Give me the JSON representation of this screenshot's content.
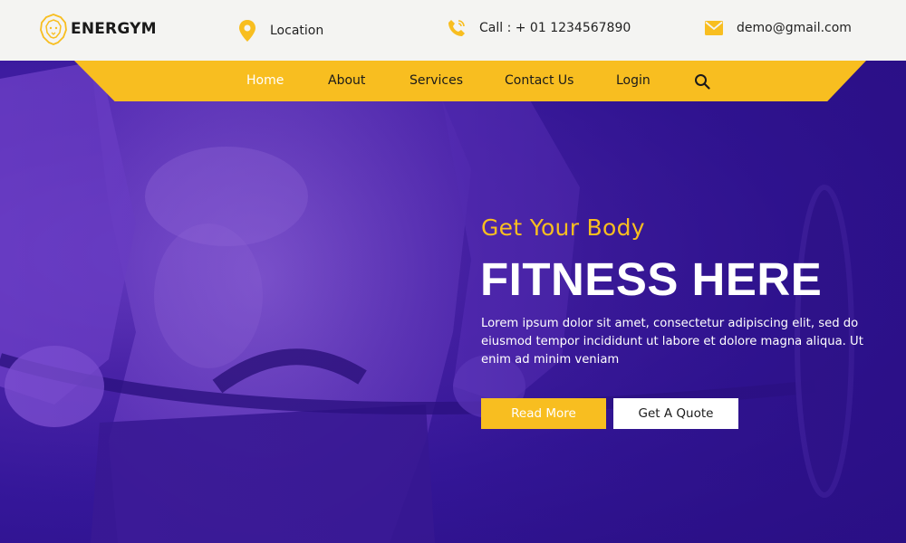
{
  "brand": {
    "name": "ENERGYM",
    "logo_icon": "lion-icon"
  },
  "contact": {
    "location": {
      "icon": "map-pin-icon",
      "text": "Location"
    },
    "phone": {
      "icon": "phone-icon",
      "text": "Call : + 01 1234567890"
    },
    "email": {
      "icon": "envelope-icon",
      "text": "demo@gmail.com"
    }
  },
  "nav": {
    "items": [
      {
        "label": "Home",
        "active": true
      },
      {
        "label": "About",
        "active": false
      },
      {
        "label": "Services",
        "active": false
      },
      {
        "label": "Contact Us",
        "active": false
      },
      {
        "label": "Login",
        "active": false
      }
    ],
    "search_icon": "search-icon"
  },
  "hero": {
    "kicker": "Get Your Body",
    "headline": "FITNESS HERE",
    "description": "Lorem ipsum dolor sit amet, consectetur adipiscing elit, sed do eiusmod tempor incididunt ut labore et dolore magna aliqua. Ut enim ad minim veniam",
    "read_more_label": "Read More",
    "quote_label": "Get A Quote"
  },
  "colors": {
    "accent": "#f8be20",
    "hero_overlay": "#3a1a9e",
    "topbar_bg": "#f4f4f2"
  }
}
